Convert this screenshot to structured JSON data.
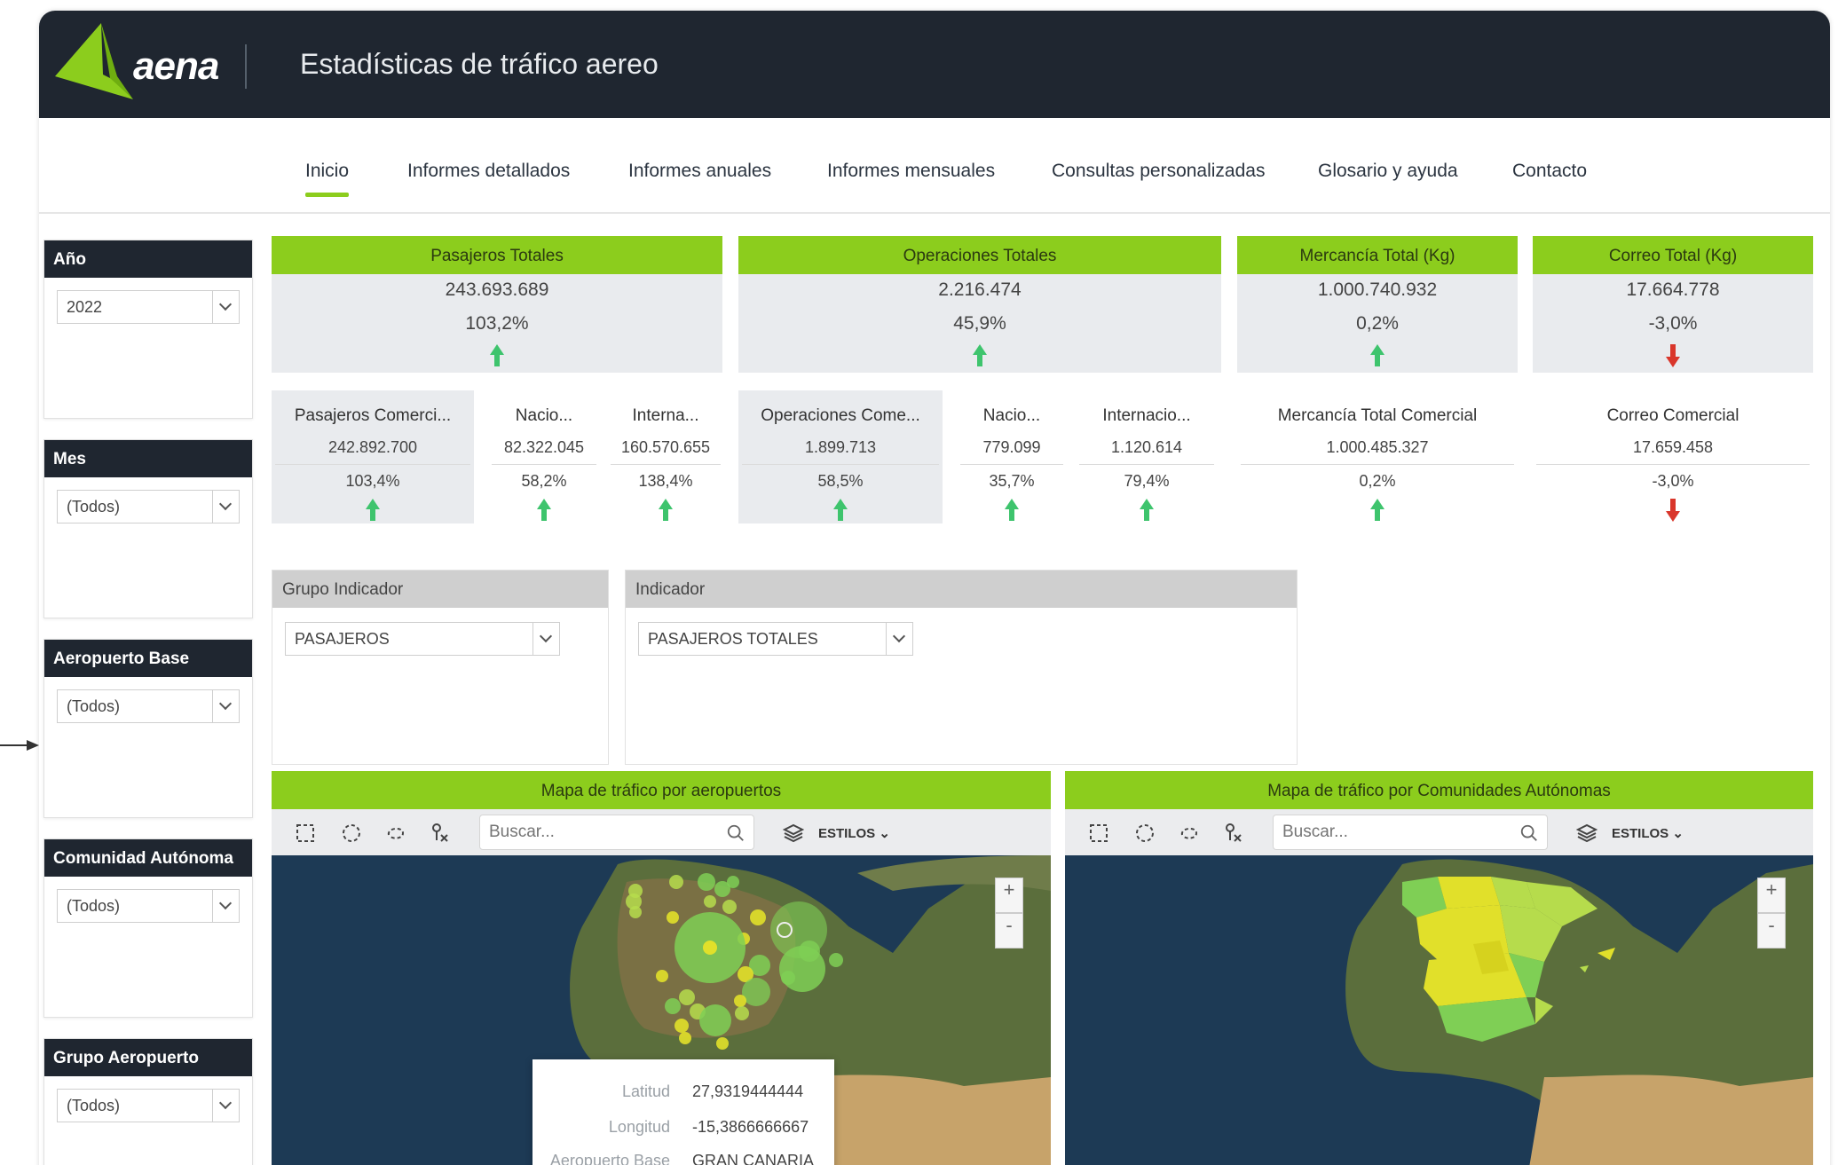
{
  "header": {
    "brand": "aena",
    "title": "Estadísticas de tráfico aereo"
  },
  "nav": {
    "items": [
      {
        "label": "Inicio",
        "active": true
      },
      {
        "label": "Informes detallados"
      },
      {
        "label": "Informes anuales"
      },
      {
        "label": "Informes mensuales"
      },
      {
        "label": "Consultas personalizadas"
      },
      {
        "label": "Glosario y ayuda"
      },
      {
        "label": "Contacto"
      }
    ]
  },
  "filters": [
    {
      "title": "Año",
      "value": "2022"
    },
    {
      "title": "Mes",
      "value": "(Todos)"
    },
    {
      "title": "Aeropuerto Base",
      "value": "(Todos)"
    },
    {
      "title": "Comunidad Autónoma",
      "value": "(Todos)"
    },
    {
      "title": "Grupo Aeropuerto",
      "value": "(Todos)"
    }
  ],
  "kpis": [
    {
      "title": "Pasajeros Totales",
      "value": "243.693.689",
      "pct": "103,2%",
      "trend": "up"
    },
    {
      "title": "Operaciones Totales",
      "value": "2.216.474",
      "pct": "45,9%",
      "trend": "up"
    },
    {
      "title": "Mercancía Total (Kg)",
      "value": "1.000.740.932",
      "pct": "0,2%",
      "trend": "up"
    },
    {
      "title": "Correo Total (Kg)",
      "value": "17.664.778",
      "pct": "-3,0%",
      "trend": "down"
    }
  ],
  "sub": [
    {
      "title": "Pasajeros Comerci...",
      "value": "242.892.700",
      "pct": "103,4%",
      "trend": "up"
    },
    {
      "title": "Nacio...",
      "value": "82.322.045",
      "pct": "58,2%",
      "trend": "up"
    },
    {
      "title": "Interna...",
      "value": "160.570.655",
      "pct": "138,4%",
      "trend": "up"
    },
    {
      "title": "Operaciones Come...",
      "value": "1.899.713",
      "pct": "58,5%",
      "trend": "up"
    },
    {
      "title": "Nacio...",
      "value": "779.099",
      "pct": "35,7%",
      "trend": "up"
    },
    {
      "title": "Internacio...",
      "value": "1.120.614",
      "pct": "79,4%",
      "trend": "up"
    },
    {
      "title": "Mercancía Total Comercial",
      "value": "1.000.485.327",
      "pct": "0,2%",
      "trend": "up"
    },
    {
      "title": "Correo Comercial",
      "value": "17.659.458",
      "pct": "-3,0%",
      "trend": "down"
    }
  ],
  "indicators": [
    {
      "title": "Grupo Indicador",
      "value": "PASAJEROS"
    },
    {
      "title": "Indicador",
      "value": "PASAJEROS TOTALES"
    }
  ],
  "maps": [
    {
      "title": "Mapa de tráfico por aeropuertos",
      "search_placeholder": "Buscar...",
      "styles_label": "ESTILOS"
    },
    {
      "title": "Mapa de tráfico por Comunidades Autónomas",
      "search_placeholder": "Buscar...",
      "styles_label": "ESTILOS"
    }
  ],
  "popup": {
    "rows": [
      {
        "key": "Latitud",
        "value": "27,9319444444"
      },
      {
        "key": "Longitud",
        "value": "-15,3866666667"
      },
      {
        "key": "Aeropuerto Base",
        "value": "GRAN CANARIA"
      }
    ]
  },
  "colors": {
    "accent": "#8ccd1d",
    "header": "#1f2630",
    "up": "#3ec46d",
    "down": "#d9362b"
  }
}
